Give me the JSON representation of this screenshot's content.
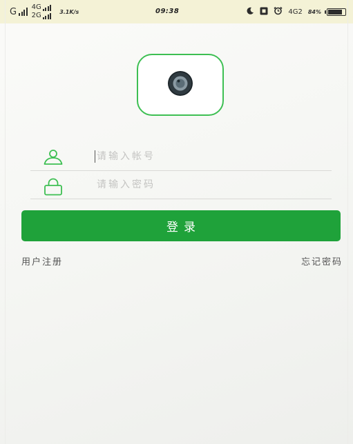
{
  "status_bar": {
    "carrier": "G",
    "net_top": "4G",
    "net_bottom": "2G",
    "speed": "3.1K/s",
    "time": "09:38",
    "net_right": "4G2",
    "battery_pct": "84%",
    "battery_level": 0.84
  },
  "colors": {
    "accent": "#1fa23a",
    "logo_border": "#3dbf52",
    "status_bar_bg": "#f4f2d6"
  },
  "logo": {
    "icon": "camera-lens-icon"
  },
  "form": {
    "account_icon": "user-icon",
    "account_placeholder": "请输入帐号",
    "account_value": "",
    "password_icon": "lock-icon",
    "password_placeholder": "请输入密码",
    "password_value": ""
  },
  "login_label": "登录",
  "links": {
    "register": "用户注册",
    "forgot": "忘记密码"
  }
}
